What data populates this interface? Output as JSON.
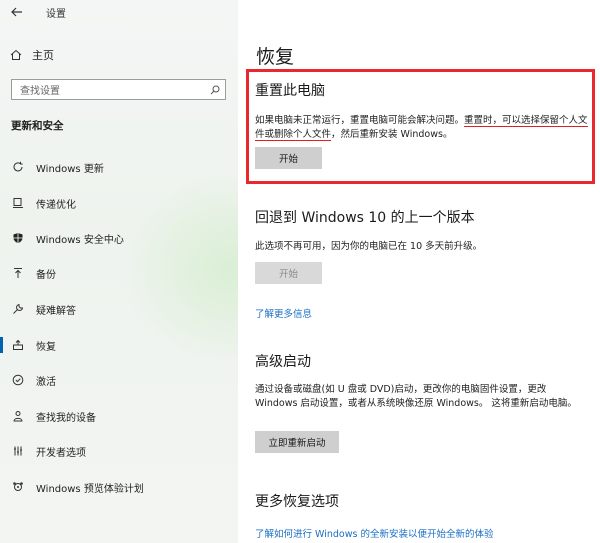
{
  "window": {
    "title": "设置"
  },
  "sidebar": {
    "home_label": "主页",
    "search_placeholder": "查找设置",
    "group_title": "更新和安全",
    "items": [
      {
        "label": "Windows 更新",
        "icon": "refresh-icon"
      },
      {
        "label": "传递优化",
        "icon": "delivery-icon"
      },
      {
        "label": "Windows 安全中心",
        "icon": "shield-icon"
      },
      {
        "label": "备份",
        "icon": "backup-icon"
      },
      {
        "label": "疑难解答",
        "icon": "wrench-icon"
      },
      {
        "label": "恢复",
        "icon": "recovery-icon"
      },
      {
        "label": "激活",
        "icon": "check-circle-icon"
      },
      {
        "label": "查找我的设备",
        "icon": "person-location-icon"
      },
      {
        "label": "开发者选项",
        "icon": "developer-icon"
      },
      {
        "label": "Windows 预览体验计划",
        "icon": "insider-icon"
      }
    ],
    "active_index": 5,
    "active_color": "#0063b1"
  },
  "main": {
    "title": "恢复",
    "reset": {
      "title": "重置此电脑",
      "text_part1": "如果电脑未正常运行，重置电脑可能会解决问题。",
      "text_underlined": "重置时，可以选择保留个人文件或删除个人文件",
      "text_part2": "，然后重新安装 Windows。",
      "button": "开始",
      "highlight_color": "#e8282c"
    },
    "goback": {
      "title": "回退到 Windows 10 的上一个版本",
      "text": "此选项不再可用，因为你的电脑已在 10 多天前升级。",
      "button": "开始",
      "link": "了解更多信息"
    },
    "advanced": {
      "title": "高级启动",
      "text": "通过设备或磁盘(如 U 盘或 DVD)启动，更改你的电脑固件设置，更改 Windows 启动设置，或者从系统映像还原 Windows。 这将重新启动电脑。",
      "button": "立即重新启动"
    },
    "more": {
      "title": "更多恢复选项",
      "link": "了解如何进行 Windows 的全新安装以便开始全新的体验"
    }
  }
}
